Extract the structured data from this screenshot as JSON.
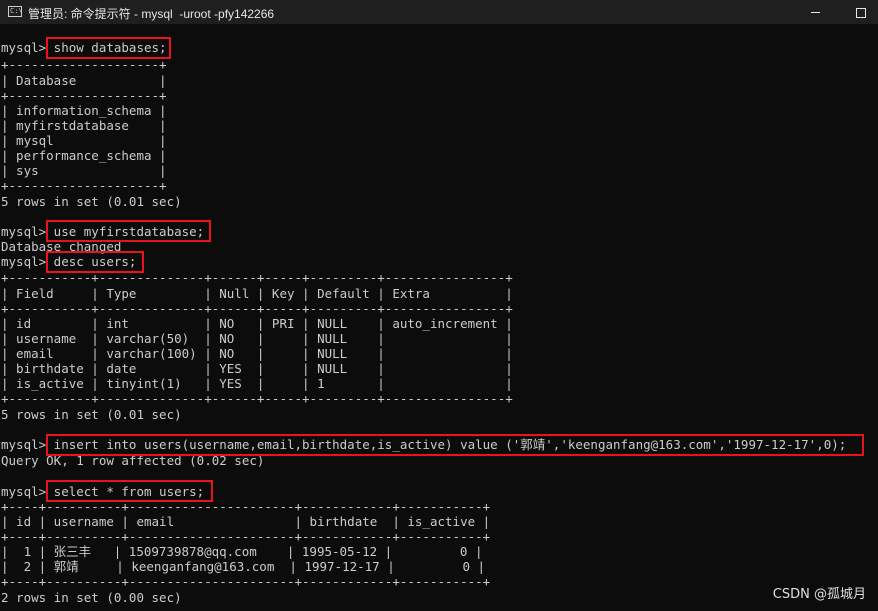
{
  "window": {
    "title": "管理员: 命令提示符 - mysql  -uroot -pfy142266",
    "icon": "console-icon",
    "controls": [
      "minimize",
      "maximize"
    ]
  },
  "console": {
    "lines": [
      "mysql> show databases;",
      "+--------------------+",
      "| Database           |",
      "+--------------------+",
      "| information_schema |",
      "| myfirstdatabase    |",
      "| mysql              |",
      "| performance_schema |",
      "| sys                |",
      "+--------------------+",
      "5 rows in set (0.01 sec)",
      "",
      "mysql> use myfirstdatabase;",
      "Database changed",
      "mysql> desc users;",
      "+-----------+--------------+------+-----+---------+----------------+",
      "| Field     | Type         | Null | Key | Default | Extra          |",
      "+-----------+--------------+------+-----+---------+----------------+",
      "| id        | int          | NO   | PRI | NULL    | auto_increment |",
      "| username  | varchar(50)  | NO   |     | NULL    |                |",
      "| email     | varchar(100) | NO   |     | NULL    |                |",
      "| birthdate | date         | YES  |     | NULL    |                |",
      "| is_active | tinyint(1)   | YES  |     | 1       |                |",
      "+-----------+--------------+------+-----+---------+----------------+",
      "5 rows in set (0.01 sec)",
      "",
      "mysql> insert into users(username,email,birthdate,is_active) value ('郭靖','keenganfang@163.com','1997-12-17',0);",
      "Query OK, 1 row affected (0.02 sec)",
      "",
      "mysql> select * from users;",
      "+----+----------+----------------------+------------+-----------+",
      "| id | username | email                | birthdate  | is_active |",
      "+----+----------+----------------------+------------+-----------+",
      "|  1 | 张三丰   | 1509739878@qq.com    | 1995-05-12 |         0 |",
      "|  2 | 郭靖     | keenganfang@163.com  | 1997-12-17 |         0 |",
      "+----+----------+----------------------+------------+-----------+",
      "2 rows in set (0.00 sec)"
    ]
  },
  "watermark": "CSDN @孤城月",
  "colors": {
    "background": "#0c0c0c",
    "text": "#cccccc",
    "highlight": "#e8141c"
  }
}
